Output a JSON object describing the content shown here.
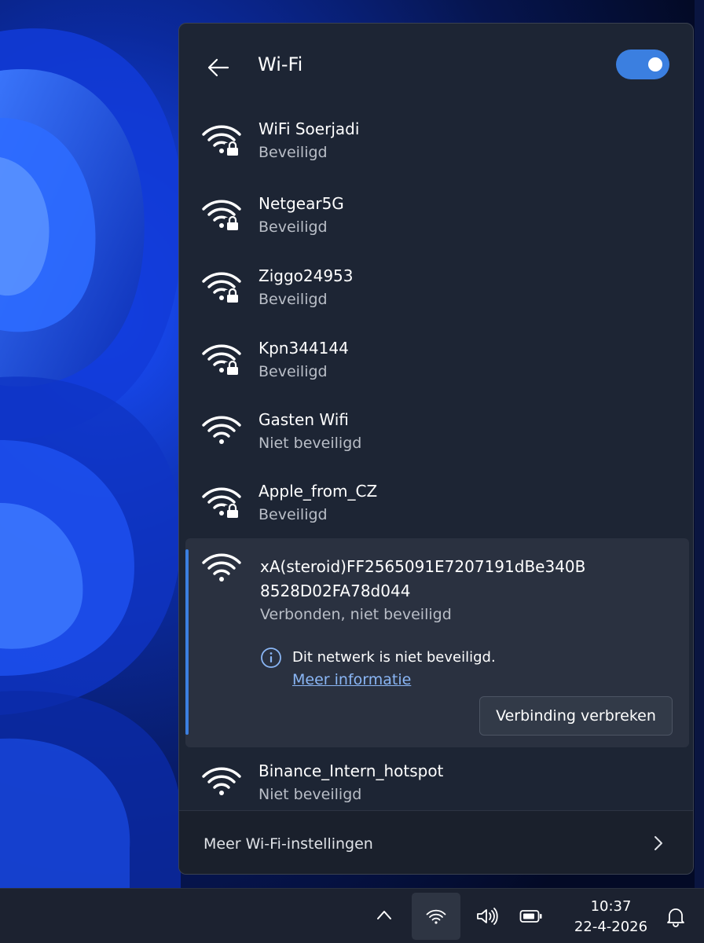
{
  "wifi_panel": {
    "title": "Wi-Fi",
    "toggle_state": "on",
    "networks": [
      {
        "name": "WiFi Soerjadi",
        "status": "Beveiligd",
        "secured": true
      },
      {
        "name": "Netgear5G",
        "status": "Beveiligd",
        "secured": true
      },
      {
        "name": "Ziggo24953",
        "status": "Beveiligd",
        "secured": true
      },
      {
        "name": "Kpn344144",
        "status": "Beveiligd",
        "secured": true
      },
      {
        "name": "Gasten Wifi",
        "status": "Niet beveiligd",
        "secured": false
      },
      {
        "name": "Apple_from_CZ",
        "status": "Beveiligd",
        "secured": true
      }
    ],
    "connected_network": {
      "name_line1": "xA(steroid)FF2565091E7207191dBe340B",
      "name_line2": "8528D02FA78d044",
      "status": "Verbonden, niet beveiligd",
      "warning": "Dit netwerk is niet beveiligd.",
      "more_info_link": "Meer informatie",
      "disconnect_button": "Verbinding verbreken"
    },
    "last_network": {
      "name": "Binance_Intern_hotspot",
      "status": "Niet beveiligd",
      "secured": false
    },
    "footer_link": "Meer Wi-Fi-instellingen"
  },
  "taskbar": {
    "time": "10:37",
    "date": "22-4-2026",
    "tray_icons": [
      "chevron-up-icon",
      "wifi-icon",
      "volume-icon",
      "battery-icon",
      "bell-icon"
    ]
  },
  "colors": {
    "accent": "#3b7fe0",
    "panel_bg": "#1d2534",
    "link": "#8ab6f5"
  }
}
